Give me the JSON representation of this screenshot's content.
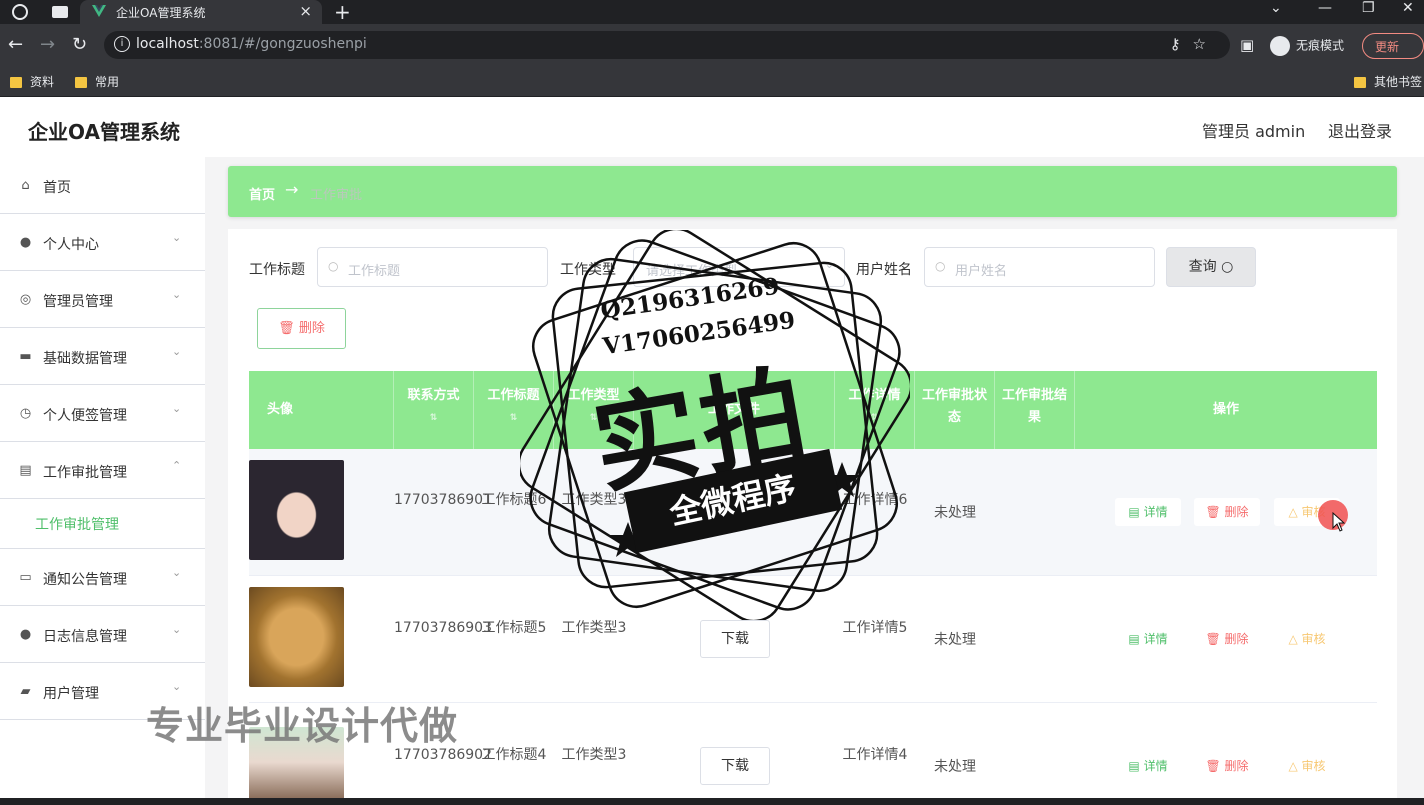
{
  "browser": {
    "tab_title": "企业OA管理系统",
    "url_host": "localhost",
    "url_rest": ":8081/#/gongzuoshenpi",
    "incognito_label": "无痕模式",
    "update_label": "更新",
    "bookmarks": [
      "资料",
      "常用"
    ],
    "other_bookmarks": "其他书签"
  },
  "header": {
    "title": "企业OA管理系统",
    "admin_label": "管理员 admin",
    "logout_label": "退出登录"
  },
  "sidebar": {
    "items": [
      {
        "label": "首页",
        "icon": "home-icon"
      },
      {
        "label": "个人中心",
        "icon": "user-icon"
      },
      {
        "label": "管理员管理",
        "icon": "compass-icon"
      },
      {
        "label": "基础数据管理",
        "icon": "suitcase-icon"
      },
      {
        "label": "个人便签管理",
        "icon": "clock-icon"
      },
      {
        "label": "工作审批管理",
        "icon": "clipboard-icon"
      },
      {
        "label": "通知公告管理",
        "icon": "ticket-icon"
      },
      {
        "label": "日志信息管理",
        "icon": "user-icon"
      },
      {
        "label": "用户管理",
        "icon": "wallet-icon"
      }
    ],
    "sub_item": "工作审批管理"
  },
  "breadcrumb": {
    "home": "首页",
    "separator": "→",
    "current": "工作审批"
  },
  "filters": {
    "title_label": "工作标题",
    "title_placeholder": "工作标题",
    "type_label": "工作类型",
    "type_placeholder": "请选择工作类型",
    "user_label": "用户姓名",
    "user_placeholder": "用户姓名",
    "query_label": "查询",
    "delete_label": "删除"
  },
  "table": {
    "columns": [
      "头像",
      "联系方式",
      "工作标题",
      "工作类型",
      "工作文件",
      "工作详情",
      "工作审批状态",
      "工作审批结果",
      "操作"
    ],
    "rows": [
      {
        "avatar": "girl-portrait",
        "phone": "17703786901",
        "title": "工作标题6",
        "type": "工作类型3",
        "file": "",
        "detail": "工作详情6",
        "status": "未处理",
        "result": ""
      },
      {
        "avatar": "puppy-photo",
        "phone": "17703786903",
        "title": "工作标题5",
        "type": "工作类型3",
        "file": "下载",
        "detail": "工作详情5",
        "status": "未处理",
        "result": ""
      },
      {
        "avatar": "woman-photo",
        "phone": "17703786902",
        "title": "工作标题4",
        "type": "工作类型3",
        "file": "下载",
        "detail": "工作详情4",
        "status": "未处理",
        "result": ""
      }
    ],
    "actions": {
      "detail": "详情",
      "remove": "删除",
      "audit": "审核"
    }
  },
  "watermark": {
    "contact_q": "Q2196316269",
    "contact_v": "V17060256499",
    "big": "实拍",
    "banner": "全微程序",
    "bottom": "专业毕业设计代做"
  },
  "colors": {
    "accent_green": "#8ee890",
    "link_green": "#4fbf6a",
    "danger": "#f56c6c",
    "warning": "#f7c873"
  }
}
